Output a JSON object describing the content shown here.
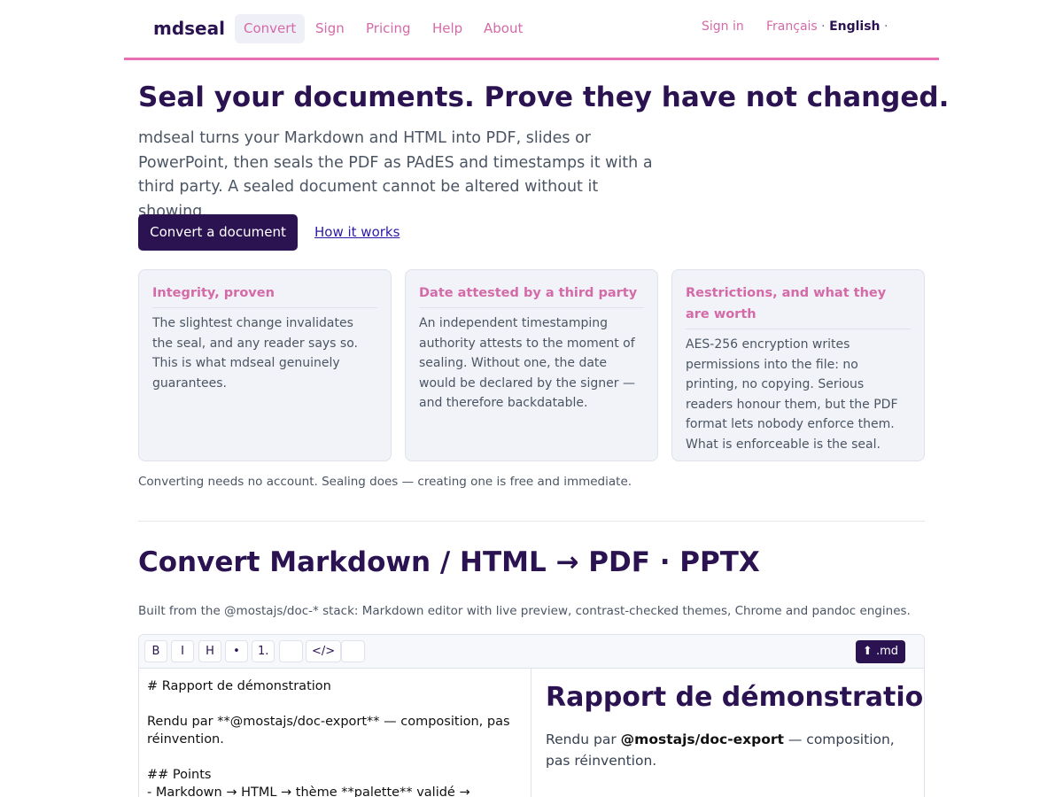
{
  "nav": {
    "brand": "mdseal",
    "items": [
      "Convert",
      "Sign",
      "Pricing",
      "Help",
      "About"
    ],
    "active": "Convert",
    "signin": "Sign in",
    "lang_fr": "Français",
    "lang_en": "English",
    "sep": "·"
  },
  "hero": {
    "title": "Seal your documents. Prove they have not changed.",
    "text": "mdseal turns your Markdown and HTML into PDF, slides or PowerPoint, then seals the PDF as PAdES and timestamps it with a third party. A sealed document cannot be altered without it showing.",
    "primary_button": "Convert a document",
    "secondary_link": "How it works"
  },
  "cards": [
    {
      "title": "Integrity, proven",
      "text": "The slightest change invalidates the seal, and any reader says so. This is what mdseal genuinely guarantees."
    },
    {
      "title": "Date attested by a third party",
      "text": "An independent timestamping authority attests to the moment of sealing. Without one, the date would be declared by the signer — and therefore backdatable."
    },
    {
      "title": "Restrictions, and what they are worth",
      "text": "AES-256 encryption writes permissions into the file: no printing, no copying. Serious readers honour them, but the PDF format lets nobody enforce them. What is enforceable is the seal."
    }
  ],
  "card_note": "Converting needs no account. Sealing does — creating one is free and immediate.",
  "convert": {
    "title": "Convert Markdown / HTML → PDF · PPTX",
    "subtitle": "Built from the @mostajs/doc-* stack: Markdown editor with live preview, contrast-checked themes, Chrome and pandoc engines.",
    "toolbar": {
      "bold": "B",
      "italic": "I",
      "heading": "H",
      "bullet": "•",
      "numbered": "1.",
      "code": "</>",
      "upload": ".md"
    },
    "source_lines": [
      "# Rapport de démonstration",
      "",
      "Rendu par **@mostajs/doc-export** — composition, pas",
      "réinvention.",
      "",
      "## Points",
      "- Markdown → HTML → thème **palette** validé →"
    ],
    "preview": {
      "title": "Rapport de démonstration",
      "text_before": "Rendu par ",
      "text_bold": "@mostajs/doc-export",
      "text_after": " — composition, pas réinvention."
    }
  }
}
